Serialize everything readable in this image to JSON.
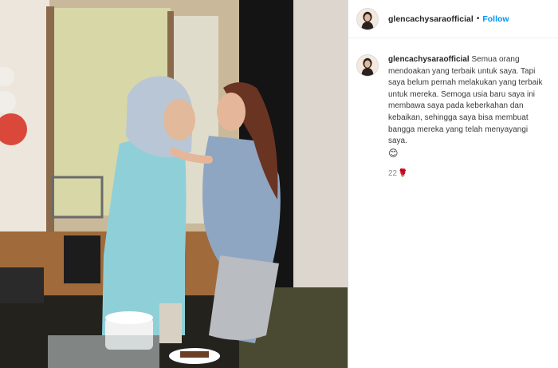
{
  "post": {
    "username": "glencachysaraofficial",
    "separator": "•",
    "follow_label": "Follow",
    "caption_user": "glencachysaraofficial",
    "caption_text": "Semua orang mendoakan yang terbaik untuk saya. Tapi saya belum pernah melakukan yang terbaik untuk mereka. Semoga usia baru saya ini membawa saya pada keberkahan dan kebaikan, sehingga saya bisa membuat bangga mereka yang telah menyayangi saya.",
    "caption_emoji": "😊",
    "comment_meta": "22",
    "comment_meta_icon": "rose-icon",
    "accent_color": "#0095f6"
  }
}
